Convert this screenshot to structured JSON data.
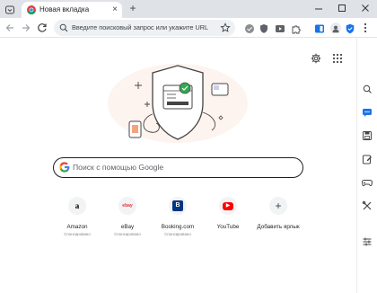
{
  "browser": {
    "tab": {
      "title": "Новая вкладка",
      "close_symbol": "×"
    },
    "new_tab_symbol": "+",
    "omnibox": {
      "placeholder": "Введите поисковый запрос или укажите URL"
    }
  },
  "search": {
    "placeholder": "Поиск с помощью Google"
  },
  "shortcuts": [
    {
      "label": "Amazon",
      "sublabel": "Спонсировано",
      "glyph": "a",
      "color": "#000000"
    },
    {
      "label": "eBay",
      "sublabel": "Спонсировано",
      "glyph": "ebay",
      "color": "#e53238"
    },
    {
      "label": "Booking.com",
      "sublabel": "Спонсировано",
      "glyph": "B",
      "color": "#003580"
    },
    {
      "label": "YouTube",
      "sublabel": "",
      "glyph": "▶",
      "color": "#ff0000"
    },
    {
      "label": "Добавить ярлык",
      "sublabel": "",
      "glyph": "+",
      "color": "#3c4043"
    }
  ],
  "icons": {
    "tab": "chrome-favicon",
    "toolbar": [
      "back-icon",
      "forward-icon",
      "reload-icon",
      "site-info-icon",
      "bookmark-star-icon"
    ],
    "side_panel": [
      "lens-icon",
      "chat-icon",
      "save-icon",
      "edit-icon",
      "gamepad-icon",
      "tools-icon",
      "sliders-icon"
    ]
  }
}
